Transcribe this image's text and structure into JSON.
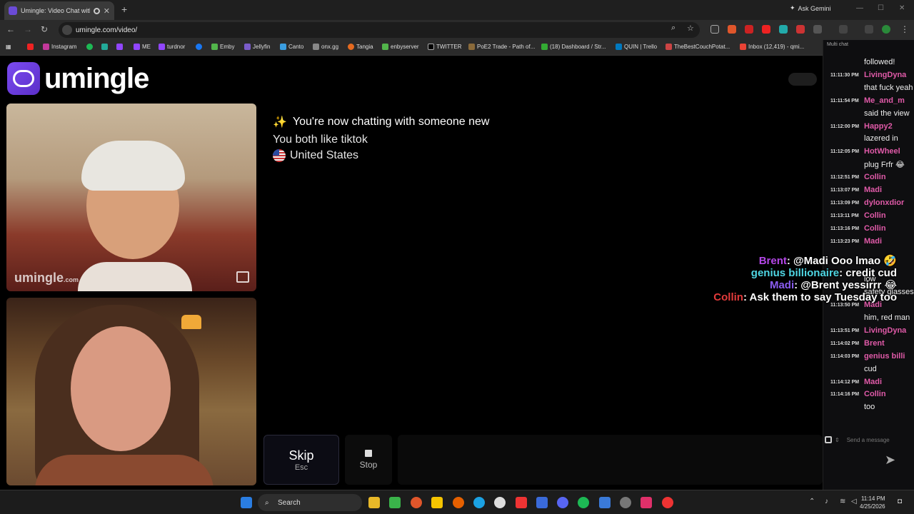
{
  "browser": {
    "tab_title": "Umingle: Video Chat with S",
    "ask_gemini": "Ask Gemini",
    "url": "umingle.com/video/",
    "bookmarks": [
      "Instagram",
      "ME",
      "turdnor",
      "Emby",
      "Jellyfin",
      "Canto",
      "onx.gg",
      "Tangia",
      "enbyserver",
      "TWITTER",
      "PoE2 Trade - Path of...",
      "(18) Dashboard / Str...",
      "QUIN | Trello",
      "TheBestCouchPotat...",
      "Inbox (12,419) - qmi..."
    ]
  },
  "site": {
    "logo_text": "umingle",
    "watermark": "umingle",
    "watermark_suffix": ".com"
  },
  "status": {
    "line1_icon": "✨",
    "line1": "You're now chatting with someone new",
    "line2": "You both like tiktok",
    "line3": "United States"
  },
  "controls": {
    "skip": "Skip",
    "skip_key": "Esc",
    "stop": "Stop"
  },
  "overlay": [
    {
      "user": "Brent",
      "text": ": @Madi Ooo lmao 🤣",
      "color": "#b447e8"
    },
    {
      "user": "genius billionaire",
      "text": ": credit cud",
      "color": "#4fd6e3"
    },
    {
      "user": "Madi",
      "text": ": @Brent yessirrr 😂",
      "color": "#8a5cf0"
    },
    {
      "user": "Collin",
      "text": ": Ask them to say Tuesday too",
      "color": "#e33b3b"
    }
  ],
  "chat": {
    "header": "Multi chat",
    "placeholder": "Send a message",
    "lines": [
      {
        "time": "",
        "user": "",
        "msg": "followed!",
        "color": "#eee"
      },
      {
        "time": "11:11:30 PM",
        "user": "LivingDyna",
        "msg": "",
        "color": "#e05aa8"
      },
      {
        "time": "",
        "user": "",
        "msg": "that fuck yeah",
        "color": "#eee"
      },
      {
        "time": "11:11:54 PM",
        "user": "Me_and_m",
        "msg": "",
        "color": "#e05aa8"
      },
      {
        "time": "",
        "user": "",
        "msg": "said the view",
        "color": "#eee"
      },
      {
        "time": "11:12:00 PM",
        "user": "Happy2",
        "msg": "",
        "color": "#e05aa8"
      },
      {
        "time": "",
        "user": "",
        "msg": "lazered in",
        "color": "#eee"
      },
      {
        "time": "11:12:05 PM",
        "user": "HotWheel",
        "msg": "",
        "color": "#e05aa8"
      },
      {
        "time": "",
        "user": "",
        "msg": "plug Frfr 😂",
        "color": "#eee"
      },
      {
        "time": "11:12:51 PM",
        "user": "Collin",
        "msg": "",
        "color": "#e05aa8"
      },
      {
        "time": "11:13:07 PM",
        "user": "Madi",
        "msg": "",
        "color": "#e05aa8"
      },
      {
        "time": "11:13:09 PM",
        "user": "dylonxdior",
        "msg": "",
        "color": "#e05aa8"
      },
      {
        "time": "11:13:11 PM",
        "user": "Collin",
        "msg": "",
        "color": "#e05aa8"
      },
      {
        "time": "11:13:16 PM",
        "user": "Collin",
        "msg": "",
        "color": "#e05aa8"
      },
      {
        "time": "11:13:23 PM",
        "user": "Madi",
        "msg": "",
        "color": "#e05aa8"
      },
      {
        "time": "",
        "user": "",
        "msg": "",
        "color": "#eee"
      },
      {
        "time": "",
        "user": "",
        "msg": "",
        "color": "#eee"
      },
      {
        "time": "",
        "user": "",
        "msg": "low",
        "color": "#eee"
      },
      {
        "time": "",
        "user": "",
        "msg": "safety glasses",
        "color": "#eee"
      },
      {
        "time": "11:13:50 PM",
        "user": "Madi",
        "msg": "",
        "color": "#e05aa8"
      },
      {
        "time": "",
        "user": "",
        "msg": "him, red man",
        "color": "#eee"
      },
      {
        "time": "11:13:51 PM",
        "user": "LivingDyna",
        "msg": "",
        "color": "#e05aa8"
      },
      {
        "time": "11:14:02 PM",
        "user": "Brent",
        "msg": "",
        "color": "#e05aa8"
      },
      {
        "time": "11:14:03 PM",
        "user": "genius billi",
        "msg": "",
        "color": "#e05aa8"
      },
      {
        "time": "",
        "user": "",
        "msg": "cud",
        "color": "#eee"
      },
      {
        "time": "11:14:12 PM",
        "user": "Madi",
        "msg": "",
        "color": "#e05aa8"
      },
      {
        "time": "11:14:16 PM",
        "user": "Collin",
        "msg": "",
        "color": "#e05aa8"
      },
      {
        "time": "",
        "user": "",
        "msg": "too",
        "color": "#eee"
      }
    ]
  },
  "taskbar": {
    "search": "Search",
    "time": "11:14 PM",
    "date": "4/25/2026"
  }
}
